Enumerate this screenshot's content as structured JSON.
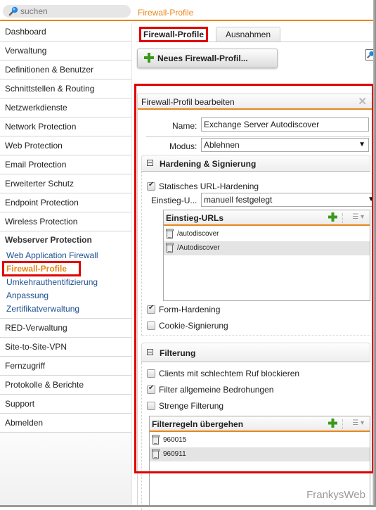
{
  "search": {
    "placeholder": "suchen",
    "icon": "magnifier-icon"
  },
  "breadcrumb": "Firewall-Profile",
  "sidebar": {
    "items_top": [
      "Dashboard",
      "Verwaltung",
      "Definitionen & Benutzer",
      "Schnittstellen & Routing",
      "Netzwerkdienste",
      "Network Protection",
      "Web Protection",
      "Email Protection",
      "Erweiterter Schutz",
      "Endpoint Protection",
      "Wireless Protection"
    ],
    "group": {
      "title": "Webserver Protection",
      "subitems": [
        {
          "label": "Web Application Firewall",
          "active": false
        },
        {
          "label": "Firewall-Profile",
          "active": true
        },
        {
          "label": "Umkehrauthentifizierung",
          "active": false
        },
        {
          "label": "Anpassung",
          "active": false
        },
        {
          "label": "Zertifikatverwaltung",
          "active": false
        }
      ]
    },
    "items_bottom": [
      "RED-Verwaltung",
      "Site-to-Site-VPN",
      "Fernzugriff",
      "Protokolle & Berichte",
      "Support",
      "Abmelden"
    ]
  },
  "tabs": [
    {
      "label": "Firewall-Profile",
      "active": true
    },
    {
      "label": "Ausnahmen",
      "active": false
    }
  ],
  "new_button": {
    "label": "Neues Firewall-Profil...",
    "icon": "plus-icon"
  },
  "panel": {
    "title": "Firewall-Profil bearbeiten",
    "close_icon": "close-icon",
    "name_label": "Name:",
    "name_value": "Exchange Server Autodiscover",
    "mode_label": "Modus:",
    "mode_value": "Ablehnen",
    "hardening": {
      "title": "Hardening & Signierung",
      "static_url_hardening": {
        "label": "Statisches URL-Hardening",
        "checked": true
      },
      "entry_label": "Einstieg-U...",
      "entry_value": "manuell festgelegt",
      "entry_urls": {
        "title": "Einstieg-URLs",
        "rows": [
          "/autodiscover",
          "/Autodiscover"
        ]
      },
      "form_hardening": {
        "label": "Form-Hardening",
        "checked": true
      },
      "cookie_signing": {
        "label": "Cookie-Signierung",
        "checked": false
      }
    },
    "filtering": {
      "title": "Filterung",
      "block_bad_reputation": {
        "label": "Clients mit schlechtem Ruf blockieren",
        "checked": false
      },
      "common_threats": {
        "label": "Filter allgemeine Bedrohungen",
        "checked": true
      },
      "strict_filtering": {
        "label": "Strenge Filterung",
        "checked": false
      },
      "skip_rules": {
        "title": "Filterregeln übergehen",
        "rows": [
          "960015",
          "960911"
        ]
      }
    }
  },
  "watermark": "FrankysWeb",
  "colors": {
    "accent": "#e8861a",
    "link": "#1d4f91",
    "highlight": "#e00000",
    "add_green": "#3a9a1a"
  }
}
